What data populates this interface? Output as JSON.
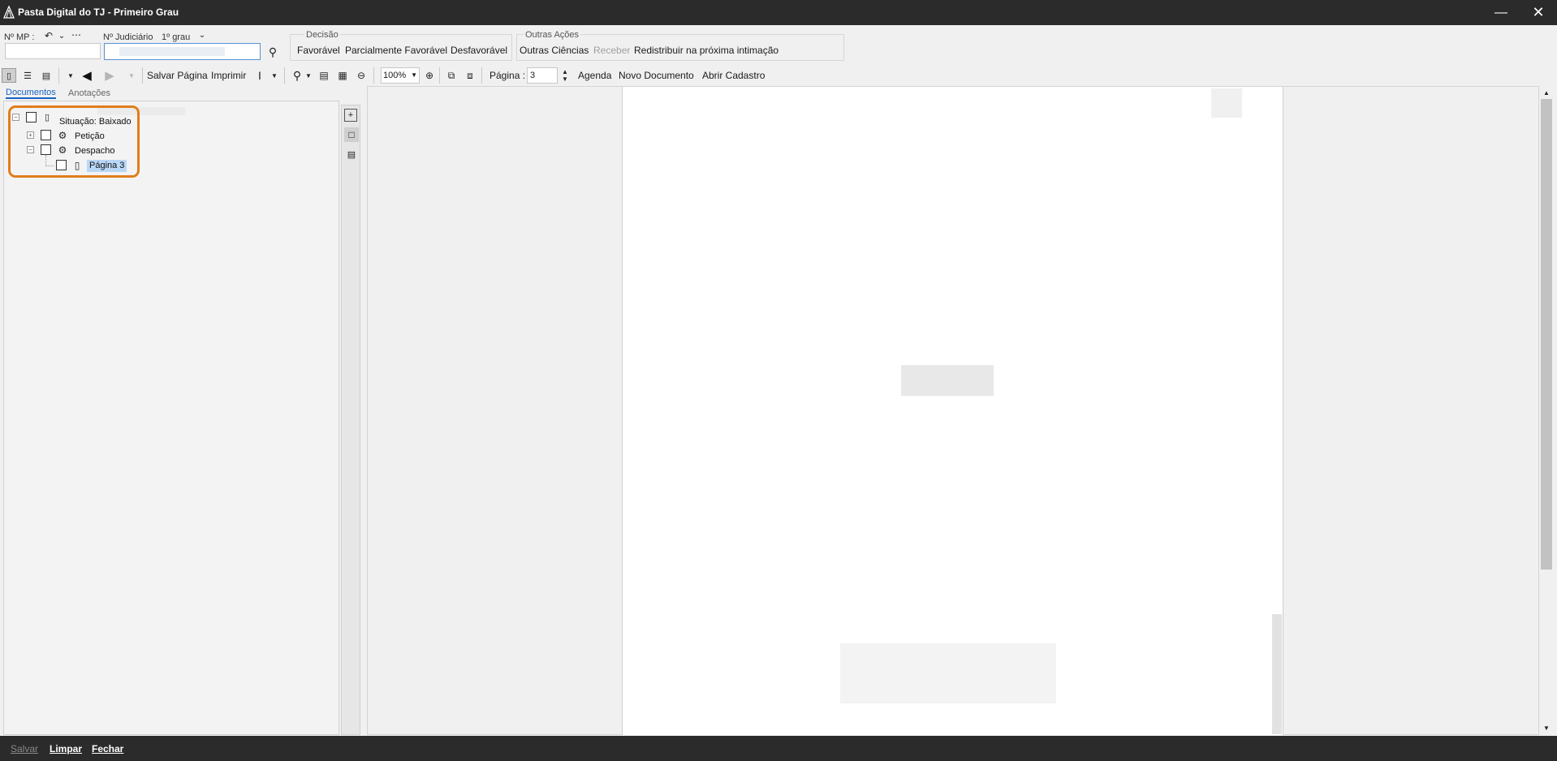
{
  "window": {
    "title": "Pasta Digital do TJ - Primeiro Grau",
    "minimize_icon": "minimize-icon",
    "close_icon": "close-icon"
  },
  "header": {
    "mp_label": "Nº MP :",
    "judiciario_label": "Nº Judiciário",
    "grau_value": "1º grau",
    "decisao": {
      "label": "Decisão",
      "items": [
        "Favorável",
        "Parcialmente Favorável",
        "Desfavorável"
      ]
    },
    "outras": {
      "label": "Outras Ações",
      "items": [
        "Outras Ciências",
        "Receber",
        "Redistribuir na próxima intimação"
      ]
    }
  },
  "toolbar": {
    "salvar_pagina": "Salvar Página",
    "imprimir": "Imprimir",
    "zoom": "100%",
    "pagina_label": "Página :",
    "pagina_value": "3",
    "agenda": "Agenda",
    "novo_documento": "Novo Documento",
    "abrir_cadastro": "Abrir Cadastro"
  },
  "left": {
    "tabs": [
      "Documentos",
      "Anotações"
    ],
    "tree": {
      "root": "Situação: Baixado",
      "items": [
        "Petição",
        "Despacho"
      ],
      "child": "Página 3"
    }
  },
  "footer": {
    "salvar": "Salvar",
    "limpar": "Limpar",
    "fechar": "Fechar"
  }
}
